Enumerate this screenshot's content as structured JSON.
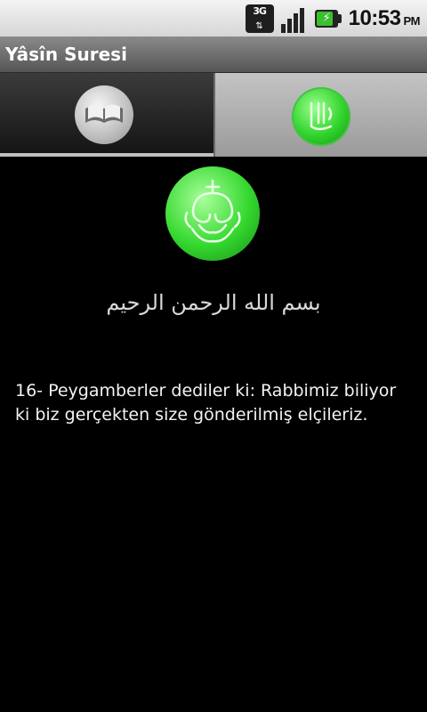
{
  "status_bar": {
    "network_label": "3G",
    "network_icon": "data-3g-icon",
    "signal_icon": "signal-strength-icon",
    "battery_icon": "battery-charging-icon",
    "time": "10:53",
    "ampm": "PM"
  },
  "app": {
    "title": "Yâsîn Suresi"
  },
  "tabs": [
    {
      "icon": "open-book-icon",
      "selected": true
    },
    {
      "icon": "allah-calligraphy-icon",
      "selected": false
    }
  ],
  "content": {
    "emblem_icon": "calligraphy-emblem-icon",
    "basmala": "بسم الله الرحمن الرحيم",
    "verse": "16- Peygamberler dediler ki: Rabbimiz biliyor ki biz gerçekten size gönderilmiş elçileriz."
  },
  "colors": {
    "accent_green": "#2fd22a",
    "background": "#000000"
  }
}
